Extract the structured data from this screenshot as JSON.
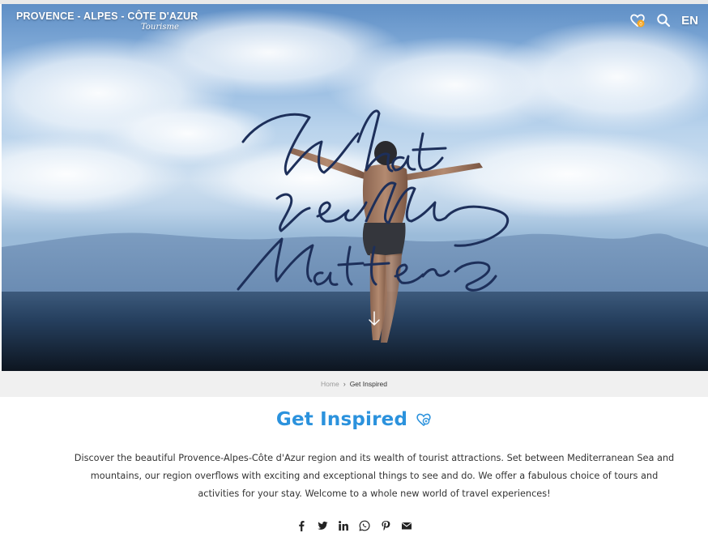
{
  "header": {
    "brand_name": "PROVENCE - ALPES - CÔTE D'AZUR",
    "brand_tagline": "Tourisme",
    "language": "EN",
    "favorites_count": "0"
  },
  "hero": {
    "script_text": "What really Matters",
    "script_lines": [
      "What",
      "really",
      "Matters"
    ]
  },
  "breadcrumb": {
    "items": [
      "Home",
      "Get Inspired"
    ],
    "separator": "›"
  },
  "page": {
    "title": "Get Inspired",
    "intro": "Discover the beautiful Provence-Alpes-Côte d'Azur region and its wealth of tourist attractions. Set between Mediterranean Sea and mountains, our region overflows with exciting and exceptional things to see and do. We offer a fabulous choice of tours and activities for your stay. Welcome to a whole new world of travel experiences!"
  },
  "share": {
    "icons": [
      "facebook-icon",
      "twitter-icon",
      "linkedin-icon",
      "whatsapp-icon",
      "pinterest-icon",
      "email-icon"
    ]
  },
  "colors": {
    "accent": "#2b92dd",
    "script_ink": "#1d2f5a",
    "badge": "#f5a623"
  }
}
